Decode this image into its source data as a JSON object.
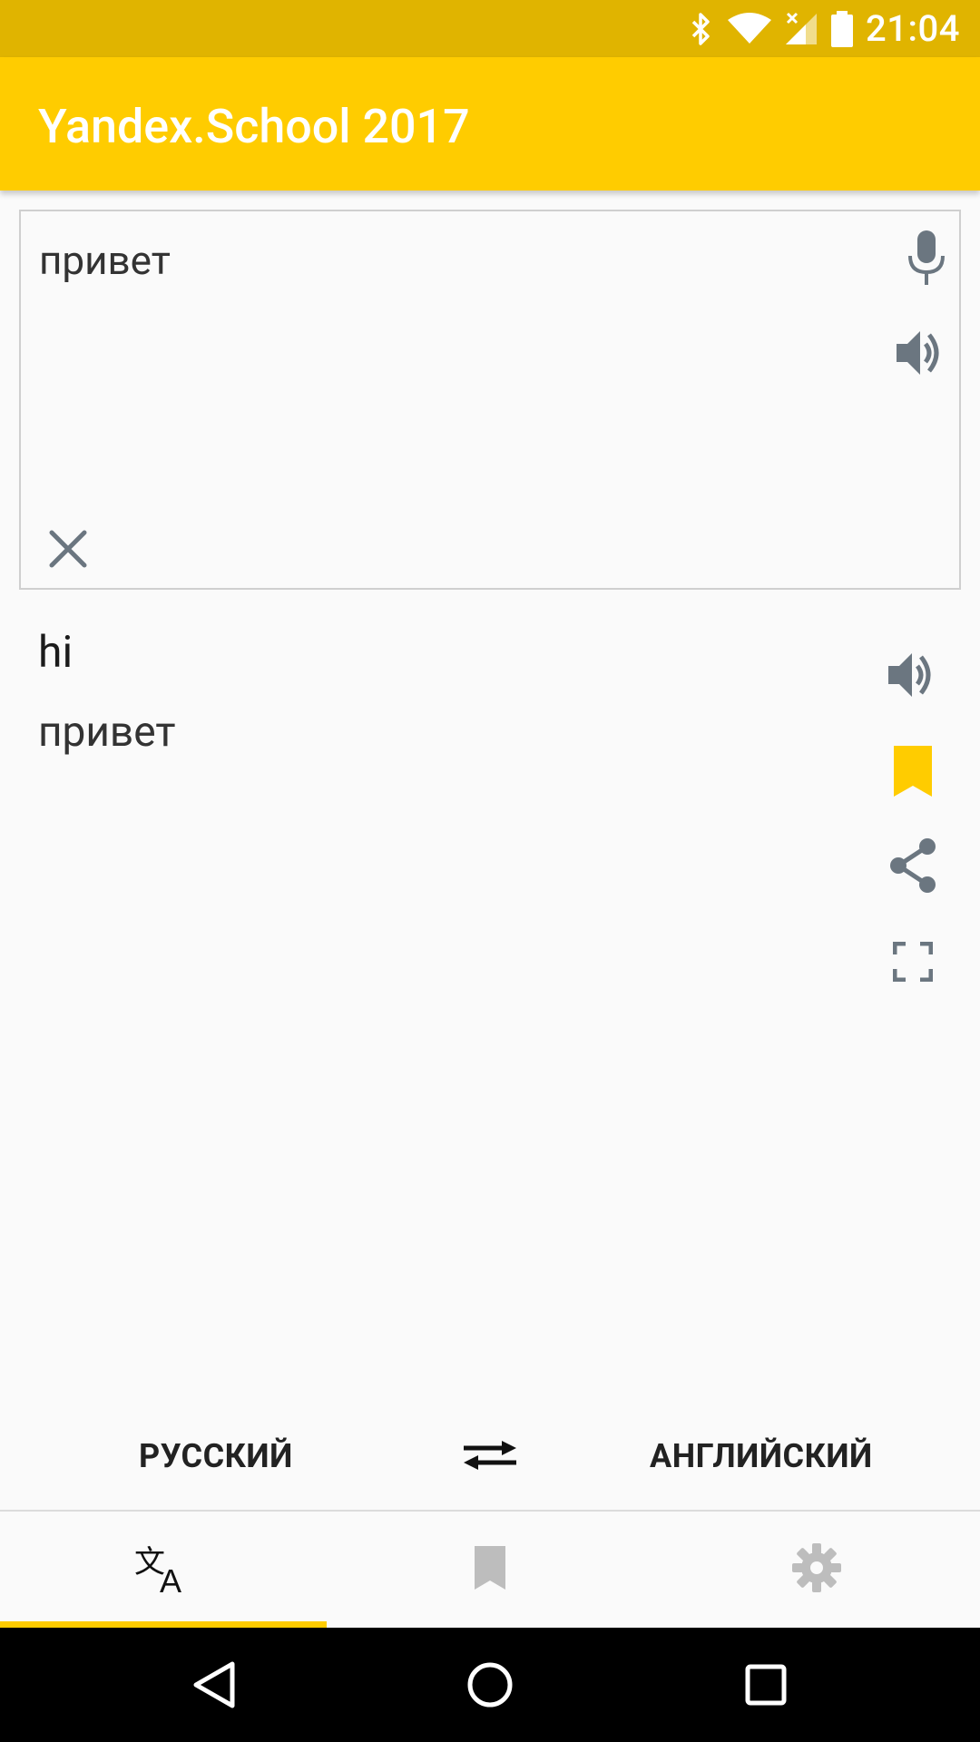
{
  "status_bar": {
    "time": "21:04",
    "icons": [
      "bluetooth-icon",
      "wifi-icon",
      "cell-signal-icon",
      "battery-icon"
    ]
  },
  "app_bar": {
    "title": "Yandex.School 2017",
    "color": "#FFCC00"
  },
  "input": {
    "text": "привет",
    "icons": [
      "microphone-icon",
      "speaker-icon",
      "clear-icon"
    ]
  },
  "result": {
    "translation": "hi",
    "source": "привет",
    "icons": [
      "speaker-icon",
      "bookmark-icon",
      "share-icon",
      "fullscreen-icon"
    ],
    "bookmark_color": "#FFCC00"
  },
  "languages": {
    "source": "РУССКИЙ",
    "target": "АНГЛИЙСКИЙ",
    "swap_icon": "swap-arrows-icon"
  },
  "tabs": [
    {
      "name": "translate-icon",
      "active": true
    },
    {
      "name": "bookmark-icon",
      "active": false
    },
    {
      "name": "gear-icon",
      "active": false
    }
  ],
  "nav": [
    "back-icon",
    "home-icon",
    "recents-icon"
  ]
}
